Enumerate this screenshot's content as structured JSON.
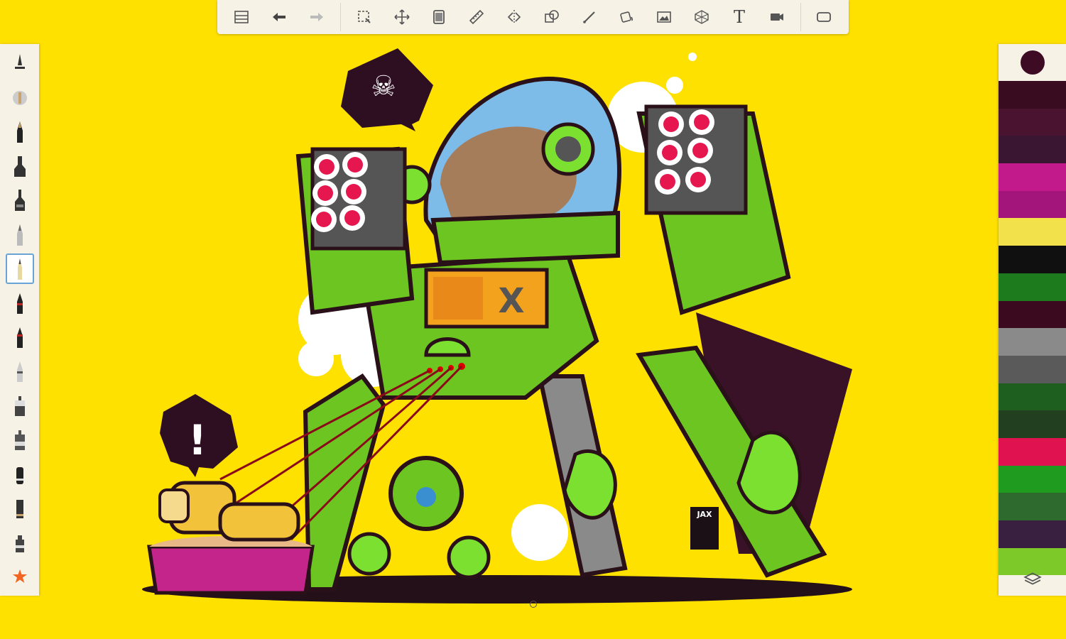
{
  "toolbar": {
    "items": [
      {
        "name": "gallery-icon"
      },
      {
        "name": "undo-icon"
      },
      {
        "name": "redo-icon"
      },
      {
        "name": "select-icon"
      },
      {
        "name": "transform-icon"
      },
      {
        "name": "canvas-size-icon"
      },
      {
        "name": "ruler-icon"
      },
      {
        "name": "symmetry-icon"
      },
      {
        "name": "shapes-icon"
      },
      {
        "name": "stroke-icon"
      },
      {
        "name": "fill-icon"
      },
      {
        "name": "image-icon"
      },
      {
        "name": "perspective-icon"
      },
      {
        "name": "text-icon",
        "label": "T"
      },
      {
        "name": "video-icon"
      },
      {
        "name": "fullscreen-icon"
      }
    ]
  },
  "brushes": {
    "selected_index": 6,
    "items": [
      "brush-tool-1",
      "brush-tool-2",
      "brush-tool-3",
      "brush-tool-4",
      "brush-tool-5",
      "brush-tool-6",
      "brush-tool-7",
      "brush-tool-8",
      "brush-tool-9",
      "brush-tool-10",
      "brush-tool-11",
      "brush-tool-12",
      "brush-tool-13",
      "brush-tool-14",
      "brush-tool-15",
      "favorites-star"
    ]
  },
  "colors": {
    "current": "#3d0c24",
    "swatches": [
      "#3a0c20",
      "#4a1430",
      "#3b1633",
      "#c21a8a",
      "#a3157a",
      "#f2e14a",
      "#101010",
      "#1d7a1d",
      "#3b0a1e",
      "#8a8a8a",
      "#5a5a5a",
      "#1e5e1e",
      "#22401f",
      "#e0124f",
      "#1f9b1f",
      "#2e6a2e",
      "#3a2040",
      "#7ec92a"
    ]
  },
  "canvas": {
    "background": "#ffe100",
    "signature_text": "JAX",
    "speech_bubble_1": "☠",
    "speech_bubble_2": "!"
  }
}
